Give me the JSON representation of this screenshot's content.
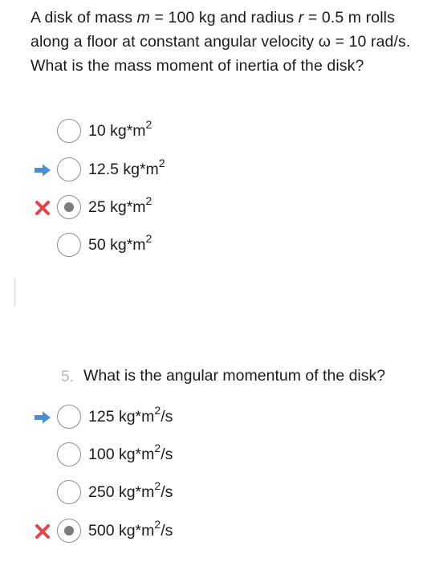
{
  "question1": {
    "text_before_m": "A disk of mass ",
    "var_m": "m",
    "text_mass_value": " = 100 kg and radius ",
    "var_r": "r",
    "text_after_r": " = 0.5 m rolls along a floor at constant angular velocity ω = 10 rad/s.  What is the mass moment of inertia of the disk?",
    "options": [
      {
        "value": "10 kg*m",
        "exp": "2",
        "unit_suffix": "",
        "selected": false,
        "marker": "none"
      },
      {
        "value": "12.5 kg*m",
        "exp": "2",
        "unit_suffix": "",
        "selected": false,
        "marker": "correct-answer-arrow"
      },
      {
        "value": "25 kg*m",
        "exp": "2",
        "unit_suffix": "",
        "selected": true,
        "marker": "incorrect-x"
      },
      {
        "value": "50 kg*m",
        "exp": "2",
        "unit_suffix": "",
        "selected": false,
        "marker": "none"
      }
    ]
  },
  "question2": {
    "number_fragment": "5.",
    "text": "What is the angular momentum of the disk?",
    "options": [
      {
        "value": "125 kg*m",
        "exp": "2",
        "unit_suffix": "/s",
        "selected": false,
        "marker": "correct-answer-arrow"
      },
      {
        "value": "100 kg*m",
        "exp": "2",
        "unit_suffix": "/s",
        "selected": false,
        "marker": "none"
      },
      {
        "value": "250 kg*m",
        "exp": "2",
        "unit_suffix": "/s",
        "selected": false,
        "marker": "none"
      },
      {
        "value": "500 kg*m",
        "exp": "2",
        "unit_suffix": "/s",
        "selected": true,
        "marker": "incorrect-x"
      }
    ]
  },
  "colors": {
    "arrow": "#4a8fd6",
    "x_mark": "#e0464a",
    "radio_border": "#8e8e8e",
    "radio_fill": "#7b7b7b",
    "text": "#1b1b1b"
  }
}
